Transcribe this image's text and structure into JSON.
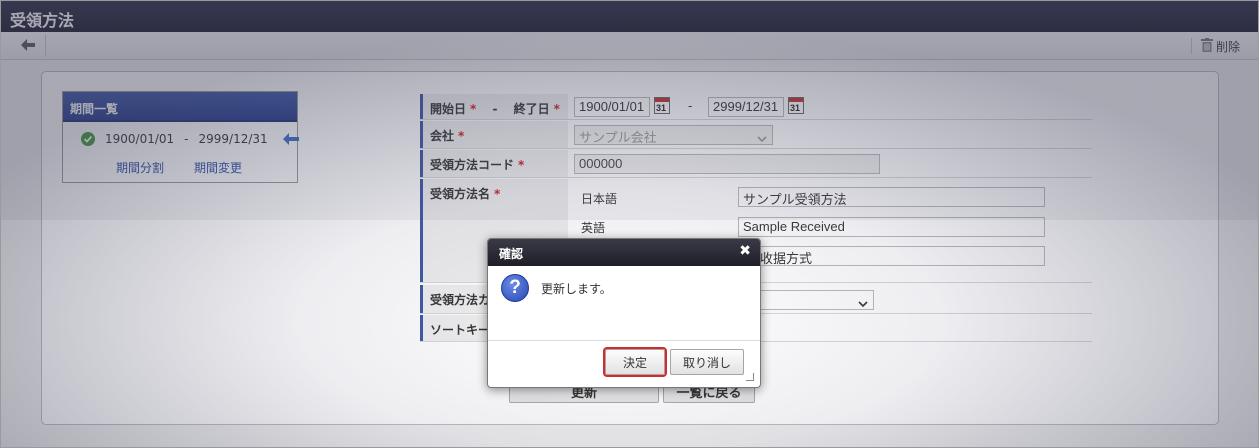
{
  "window": {
    "title": "受領方法"
  },
  "toolbar": {
    "delete_label": "削除"
  },
  "period_list": {
    "header": "期間一覧",
    "start": "1900/01/01",
    "separator": "-",
    "end": "2999/12/31",
    "split_link": "期間分割",
    "change_link": "期間変更"
  },
  "form": {
    "period_label_start": "開始日",
    "period_label_sep": "-",
    "period_label_end": "終了日",
    "required_mark": "*",
    "start_date": "1900/01/01",
    "date_sep": "-",
    "end_date": "2999/12/31",
    "calendar_day": "31",
    "company_label": "会社",
    "company_value": "サンプル会社",
    "code_label": "受領方法コード",
    "code_value": "000000",
    "name_label": "受領方法名",
    "names": [
      {
        "lang": "日本語",
        "value": "サンプル受領方法"
      },
      {
        "lang": "英語",
        "value": "Sample Received"
      },
      {
        "lang": "",
        "value": "本收据方式"
      }
    ],
    "category_label": "受領方法カ",
    "sort_key_label": "ソートキー"
  },
  "buttons": {
    "update": "更新",
    "back_to_list": "一覧に戻る"
  },
  "dialog": {
    "title": "確認",
    "close_glyph": "✖",
    "icon_glyph": "?",
    "message": "更新します。",
    "confirm_label": "決定",
    "cancel_label": "取り消し"
  },
  "colors": {
    "accent": "#3a56a6",
    "titlebar": "#1f2033",
    "required": "#d02020",
    "highlight": "#d42a2a"
  }
}
